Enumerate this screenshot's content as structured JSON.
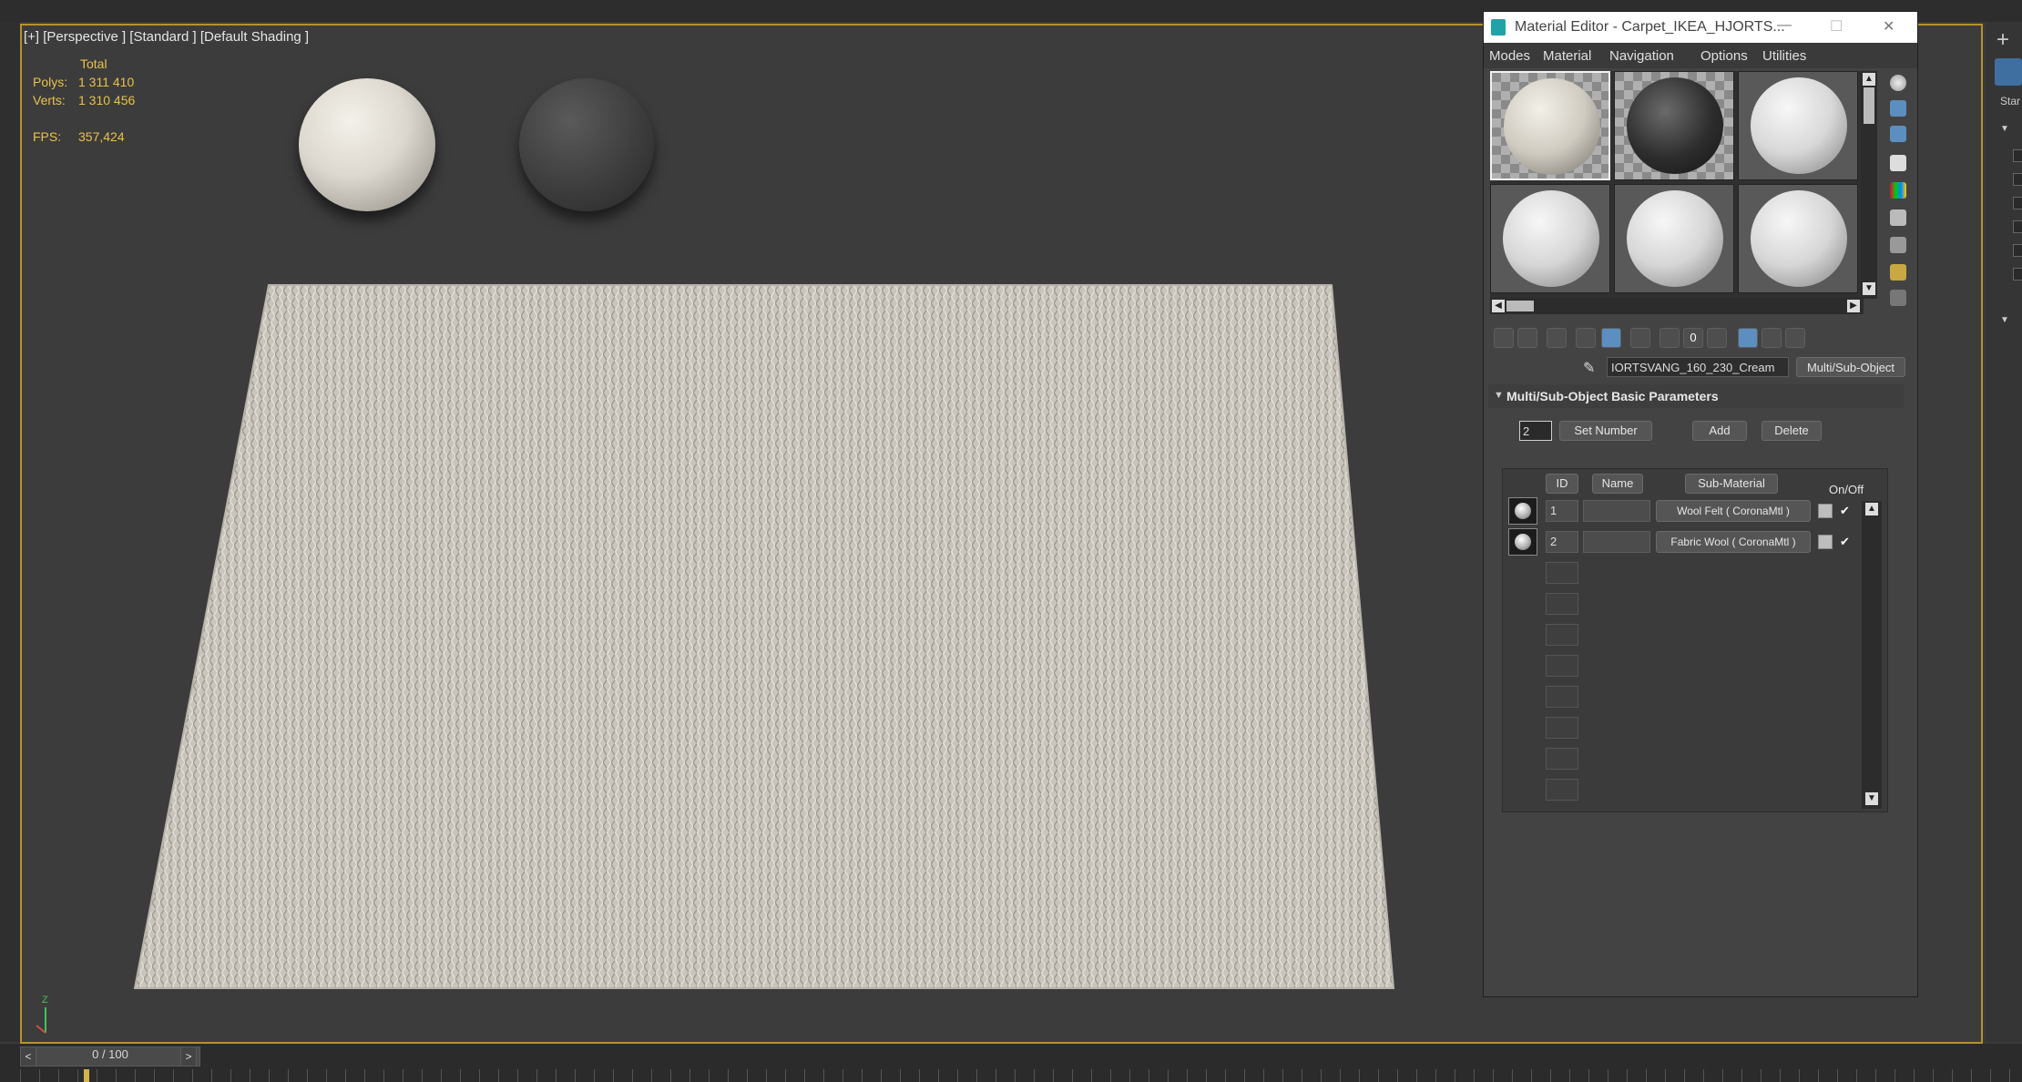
{
  "viewport": {
    "label": "[+] [Perspective ] [Standard ] [Default Shading ]",
    "stats": {
      "total_label": "Total",
      "polys_label": "Polys:",
      "polys_value": "1 311 410",
      "verts_label": "Verts:",
      "verts_value": "1 310 456",
      "fps_label": "FPS:",
      "fps_value": "357,424"
    },
    "axis_label": "Z"
  },
  "timeline": {
    "frame_text": "0 / 100",
    "prev_label": "<",
    "next_label": ">"
  },
  "material_editor": {
    "title": "Material Editor - Carpet_IKEA_HJORTS...",
    "menu": [
      "Modes",
      "Material",
      "Navigation",
      "Options",
      "Utilities"
    ],
    "material_name": "IORTSVANG_160_230_Cream",
    "material_type": "Multi/Sub-Object",
    "rollout_title": "Multi/Sub-Object Basic Parameters",
    "set_number_value": "2",
    "set_number_label": "Set Number",
    "add_label": "Add",
    "delete_label": "Delete",
    "columns": {
      "id": "ID",
      "name": "Name",
      "sub_material": "Sub-Material",
      "on_off": "On/Off"
    },
    "rows": [
      {
        "id": "1",
        "name": "",
        "sub_material": "Wool Felt  ( CoronaMtl )",
        "enabled": "✔"
      },
      {
        "id": "2",
        "name": "",
        "sub_material": "Fabric Wool  ( CoronaMtl )",
        "enabled": "✔"
      }
    ]
  },
  "right_panel": {
    "plus": "+",
    "label": "Star"
  }
}
